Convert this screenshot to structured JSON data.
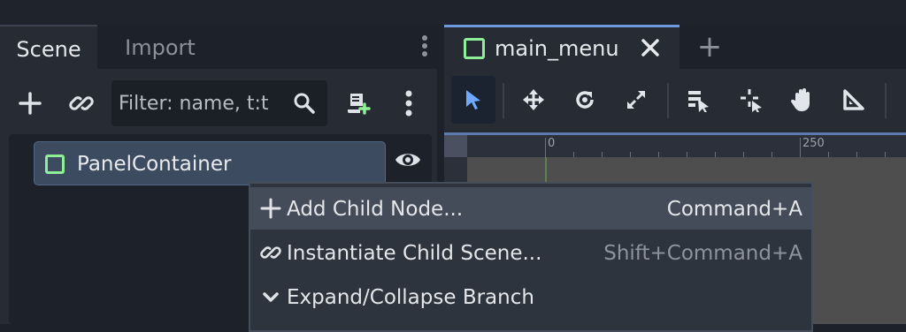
{
  "scene_dock": {
    "tabs": [
      {
        "label": "Scene"
      },
      {
        "label": "Import"
      }
    ],
    "toolbar": {
      "add_icon": "plus-icon",
      "instance_icon": "link-icon",
      "filter_placeholder": "Filter: name, t:t",
      "search_icon": "search-icon",
      "script_icon": "attach-script-icon",
      "menu_icon": "kebab-menu-icon"
    },
    "tree": {
      "nodes": [
        {
          "label": "PanelContainer",
          "icon": "panel-container-icon",
          "visible": true
        }
      ]
    }
  },
  "editor": {
    "tabs": [
      {
        "label": "main_menu",
        "close_icon": "close-icon"
      }
    ],
    "add_tab_label": "+",
    "toolbar_icons": [
      "select-icon",
      "move-icon",
      "rotate-icon",
      "scale-icon",
      "list-select-icon",
      "pivot-icon",
      "pan-icon",
      "ruler-icon"
    ],
    "ruler": {
      "labels": [
        "0",
        "250"
      ]
    }
  },
  "context_menu": {
    "items": [
      {
        "icon": "plus-icon",
        "label": "Add Child Node...",
        "shortcut": "Command+A",
        "highlighted": true
      },
      {
        "icon": "link-icon",
        "label": "Instantiate Child Scene...",
        "shortcut": "Shift+Command+A",
        "highlighted": false
      },
      {
        "icon": "chevron-down-icon",
        "label": "Expand/Collapse Branch",
        "shortcut": "",
        "highlighted": false
      }
    ]
  },
  "colors": {
    "accent": "#6f9ae0",
    "node_green": "#8eef97",
    "selection": "#3c4b60",
    "shortcut_primary": "#e4e6ea",
    "shortcut_muted": "#8d939c"
  }
}
